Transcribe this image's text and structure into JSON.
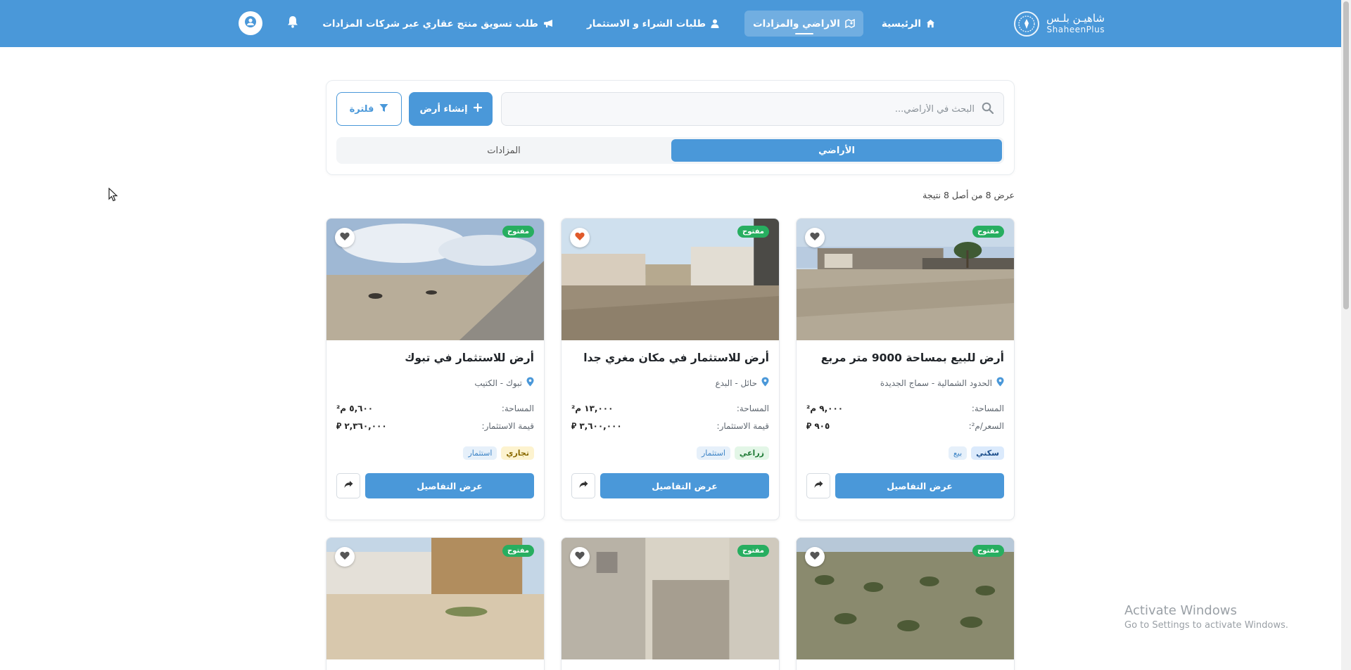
{
  "brand": {
    "name_ar": "شاهيـن بلـس",
    "name_en": "ShaheenPlus"
  },
  "nav": {
    "home": "الرئيسية",
    "lands": "الاراضي والمزادات",
    "requests": "طلبات الشراء و الاستثمار",
    "marketing": "طلب تسويق منتج عقاري عبر شركات المزادات"
  },
  "search": {
    "placeholder": "البحث في الأراضي...",
    "create_label": "إنشاء أرض",
    "filter_label": "فلترة"
  },
  "tabs": {
    "lands": "الأراضي",
    "auctions": "المزادات",
    "active": "lands"
  },
  "results": {
    "text": "عرض 8 من أصل 8 نتيجة"
  },
  "common": {
    "open_badge": "مفتوح",
    "details_label": "عرض التفاصيل",
    "area_label": "المساحة:",
    "invest_label": "قيمة الاستثمار:",
    "price_label": "السعر/م²:"
  },
  "cards": [
    {
      "title": "أرض للبيع بمساحة 9000 متر مربع",
      "location": "الحدود الشمالية - سماج الجديدة",
      "area": "٩,٠٠٠ م²",
      "price": "٩٠٥ ⃁",
      "tags": [
        "سكني",
        "بيع"
      ],
      "favorite": false
    },
    {
      "title": "أرض للاستثمار في مكان مغري جدا",
      "location": "حائل - البدع",
      "area": "١٣,٠٠٠ م²",
      "price": "٣,٦٠٠,٠٠٠ ⃁",
      "tags": [
        "زراعي",
        "استثمار"
      ],
      "favorite": true
    },
    {
      "title": "أرض للاستثمار في تبوك",
      "location": "تبوك - الكتيب",
      "area": "٥,٦٠٠ م²",
      "price": "٢,٣٦٠,٠٠٠ ⃁",
      "tags": [
        "تجاري",
        "استثمار"
      ],
      "favorite": false
    }
  ],
  "watermark": {
    "line1": "Activate Windows",
    "line2": "Go to Settings to activate Windows."
  },
  "colors": {
    "primary": "#4a98d9",
    "open": "#27ae60",
    "favorite": "#e05a2b"
  }
}
